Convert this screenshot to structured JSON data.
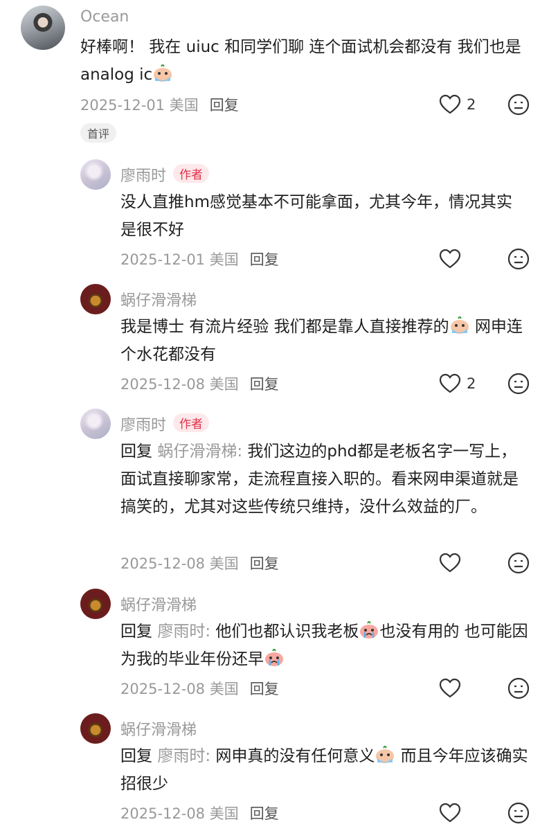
{
  "comments": [
    {
      "name": "Ocean",
      "text": "好棒啊！  我在 uiuc 和同学们聊 连个面试机会都没有 我们也是 analog ic",
      "date": "2025-12-01 美国",
      "reply": "回复",
      "likes": "2",
      "badge": "首评"
    },
    {
      "name": "廖雨时",
      "tag": "作者",
      "text": "没人直推hm感觉基本不可能拿面，尤其今年，情况其实是很不好",
      "date": "2025-12-01 美国",
      "reply": "回复",
      "likes": ""
    },
    {
      "name": "蜗仔滑滑梯",
      "text_a": "我是博士 有流片经验 我们都是靠人直接推荐的",
      "text_b": " 网申连个水花都没有",
      "date": "2025-12-08 美国",
      "reply": "回复",
      "likes": "2"
    },
    {
      "name": "廖雨时",
      "tag": "作者",
      "reply_prefix": "回复",
      "reply_to": "蜗仔滑滑梯:",
      "text": " 我们这边的phd都是老板名字一写上，面试直接聊家常，走流程直接入职的。看来网申渠道就是搞笑的，尤其对这些传统只维持，没什么效益的厂。",
      "date": "2025-12-08 美国",
      "reply": "回复",
      "likes": ""
    },
    {
      "name": "蜗仔滑滑梯",
      "reply_prefix": "回复",
      "reply_to": "廖雨时:",
      "text_a": " 他们也都认识我老板",
      "text_b": "也没有用的 也可能因为我的毕业年份还早",
      "date": "2025-12-08 美国",
      "reply": "回复",
      "likes": ""
    },
    {
      "name": "蜗仔滑滑梯",
      "reply_prefix": "回复",
      "reply_to": "廖雨时:",
      "text_a": " 网申真的没有任何意义",
      "text_b": " 而且今年应该确实招很少",
      "date": "2025-12-08 美国",
      "reply": "回复",
      "likes": ""
    }
  ],
  "icons": {
    "like": "heart-outline-icon",
    "dislike": "dislike-face-icon",
    "emoji_cry": "crying-emoji",
    "emoji_sweat": "sweating-emoji"
  },
  "colors": {
    "tag_text": "#e0324a",
    "tag_bg": "#fde8ea",
    "muted": "#999999"
  }
}
